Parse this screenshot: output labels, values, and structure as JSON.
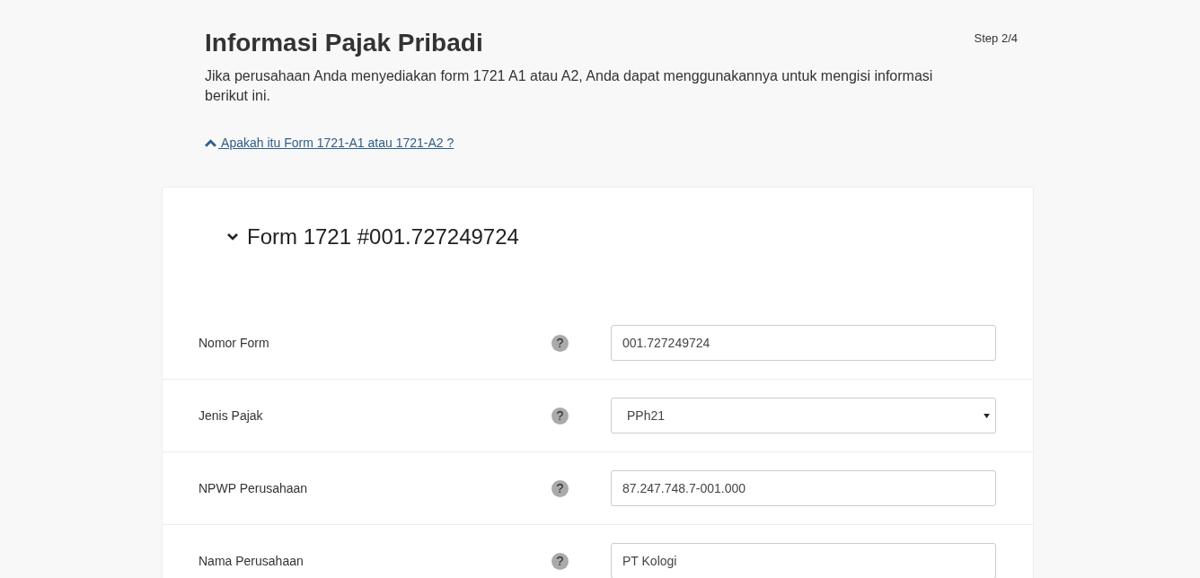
{
  "header": {
    "title": "Informasi Pajak Pribadi",
    "step": "Step 2/4",
    "description": "Jika perusahaan Anda menyediakan form 1721 A1 atau A2, Anda dapat menggunakannya untuk mengisi informasi berikut ini.",
    "help_link": {
      "label": " Apakah itu Form 1721-A1 atau 1721-A2 ?",
      "expanded": true
    }
  },
  "form": {
    "title": "Form 1721 #001.727249724",
    "expanded": true,
    "fields": [
      {
        "kind": "text",
        "label": "Nomor Form",
        "help": "?",
        "value": "001.727249724"
      },
      {
        "kind": "select",
        "label": "Jenis Pajak",
        "help": "?",
        "value": "PPh21"
      },
      {
        "kind": "text",
        "label": "NPWP Perusahaan",
        "help": "?",
        "value": "87.247.748.7-001.000"
      },
      {
        "kind": "text",
        "label": "Nama Perusahaan",
        "help": "?",
        "value": "PT Kologi"
      }
    ]
  }
}
